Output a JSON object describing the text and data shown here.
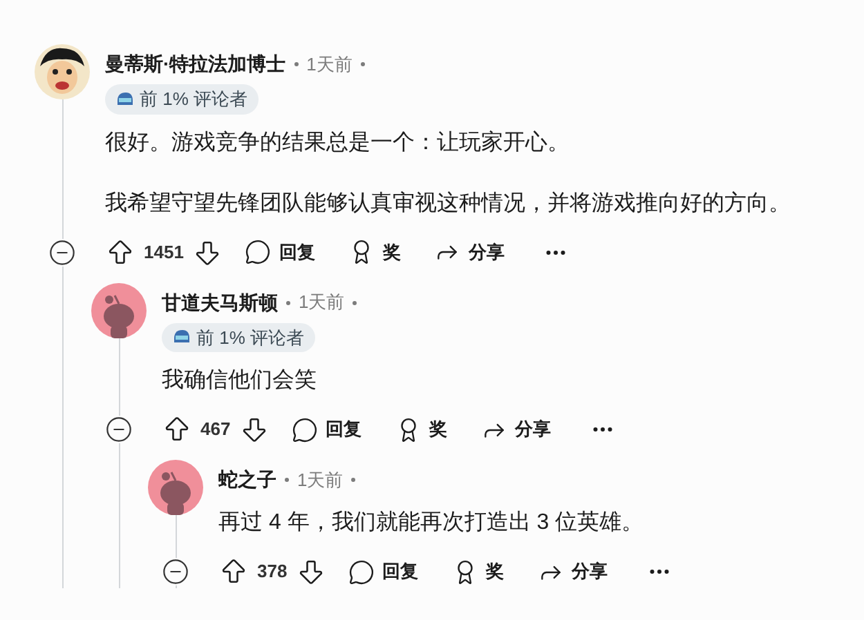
{
  "comments": [
    {
      "author": "曼蒂斯·特拉法加博士",
      "avatar": {
        "kind": "cartoon"
      },
      "time": "1天前",
      "badge": "前 1% 评论者",
      "paragraphs": [
        "很好。游戏竞争的结果总是一个：让玩家开心。",
        "我希望守望先锋团队能够认真审视这种情况，并将游戏推向好的方向。"
      ],
      "votes": "1451",
      "reply": "回复",
      "award": "奖",
      "share": "分享",
      "children": [
        {
          "author": "甘道夫马斯顿",
          "avatar": {
            "kind": "default"
          },
          "time": "1天前",
          "badge": "前 1% 评论者",
          "paragraphs": [
            "我确信他们会笑"
          ],
          "votes": "467",
          "reply": "回复",
          "award": "奖",
          "share": "分享",
          "children": [
            {
              "author": "蛇之子",
              "avatar": {
                "kind": "default"
              },
              "time": "1天前",
              "paragraphs": [
                "再过 4 年，我们就能再次打造出 3 位英雄。"
              ],
              "votes": "378",
              "reply": "回复",
              "award": "奖",
              "share": "分享"
            }
          ]
        }
      ]
    }
  ]
}
